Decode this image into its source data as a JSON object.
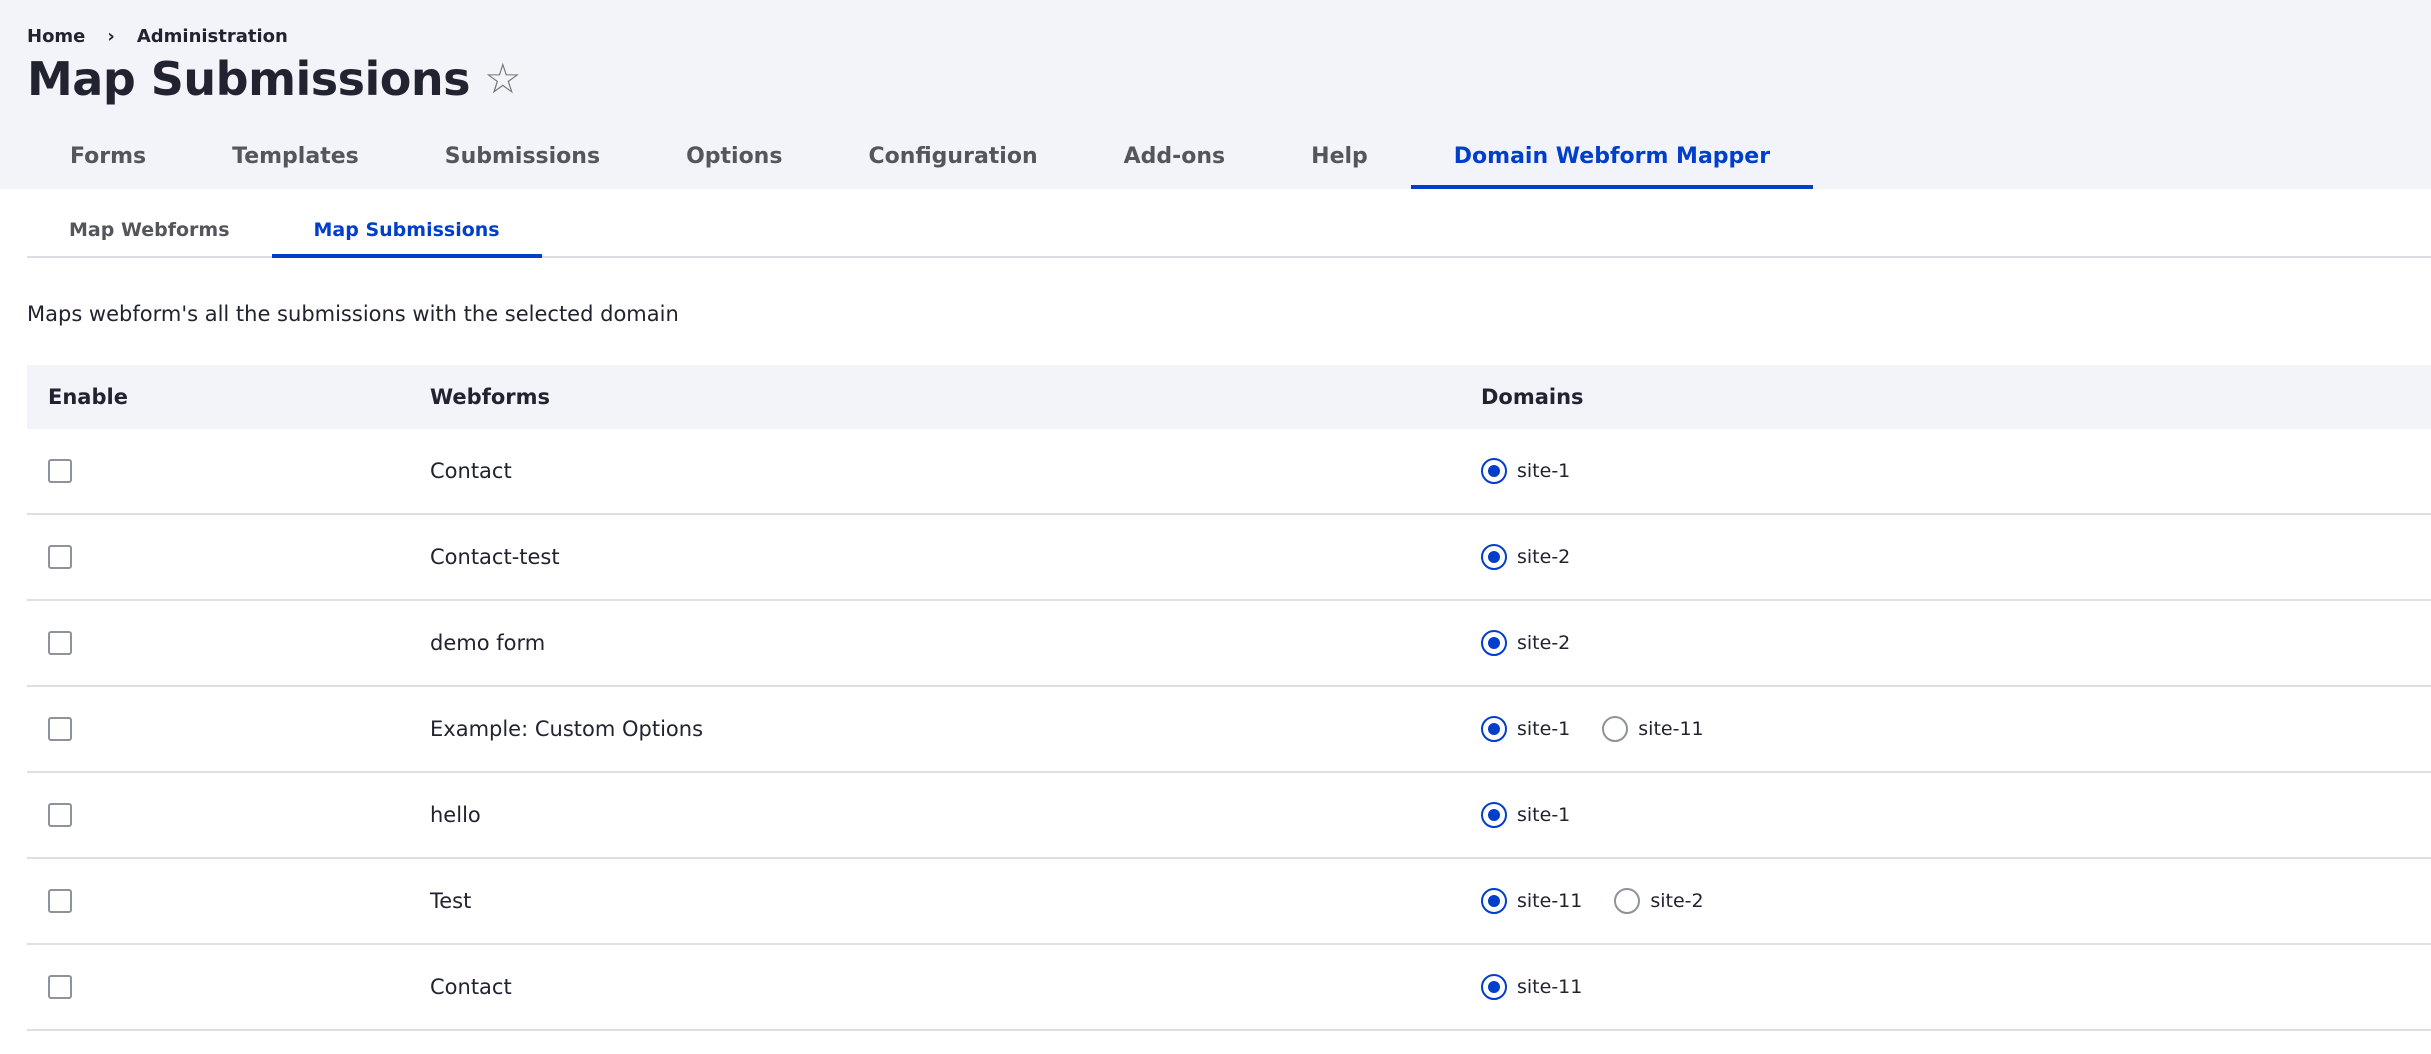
{
  "breadcrumb": {
    "home": "Home",
    "separator": "›",
    "admin": "Administration"
  },
  "page_title": "Map Submissions",
  "star_icon": "☆",
  "primary_tabs": [
    {
      "label": "Forms",
      "active": false
    },
    {
      "label": "Templates",
      "active": false
    },
    {
      "label": "Submissions",
      "active": false
    },
    {
      "label": "Options",
      "active": false
    },
    {
      "label": "Configuration",
      "active": false
    },
    {
      "label": "Add-ons",
      "active": false
    },
    {
      "label": "Help",
      "active": false
    },
    {
      "label": "Domain Webform Mapper",
      "active": true
    }
  ],
  "secondary_tabs": [
    {
      "label": "Map Webforms",
      "active": false
    },
    {
      "label": "Map Submissions",
      "active": true
    }
  ],
  "description": "Maps webform's all the submissions with the selected domain",
  "table": {
    "headers": {
      "enable": "Enable",
      "webforms": "Webforms",
      "domains": "Domains"
    },
    "rows": [
      {
        "webform": "Contact",
        "enabled": false,
        "domains": [
          {
            "label": "site-1",
            "checked": true
          }
        ]
      },
      {
        "webform": "Contact-test",
        "enabled": false,
        "domains": [
          {
            "label": "site-2",
            "checked": true
          }
        ]
      },
      {
        "webform": "demo form",
        "enabled": false,
        "domains": [
          {
            "label": "site-2",
            "checked": true
          }
        ]
      },
      {
        "webform": "Example: Custom Options",
        "enabled": false,
        "domains": [
          {
            "label": "site-1",
            "checked": true
          },
          {
            "label": "site-11",
            "checked": false
          }
        ]
      },
      {
        "webform": "hello",
        "enabled": false,
        "domains": [
          {
            "label": "site-1",
            "checked": true
          }
        ]
      },
      {
        "webform": "Test",
        "enabled": false,
        "domains": [
          {
            "label": "site-11",
            "checked": true
          },
          {
            "label": "site-2",
            "checked": false
          }
        ]
      },
      {
        "webform": "Contact",
        "enabled": false,
        "domains": [
          {
            "label": "site-11",
            "checked": true
          }
        ]
      }
    ]
  },
  "colors": {
    "accent": "#003ecc",
    "header_bg": "#f3f4f9",
    "text": "#222330"
  }
}
